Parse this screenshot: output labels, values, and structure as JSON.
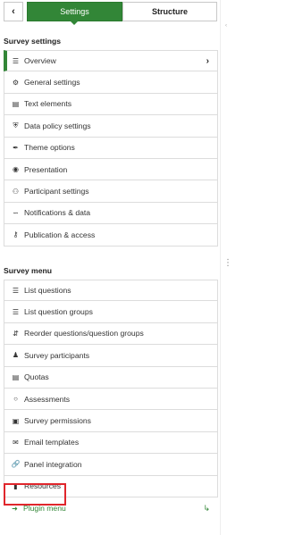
{
  "tabs": {
    "collapse_icon": "chevron-left",
    "settings_label": "Settings",
    "structure_label": "Structure"
  },
  "survey_settings": {
    "title": "Survey settings",
    "items": [
      {
        "label": "Overview",
        "icon": "list-icon"
      },
      {
        "label": "General settings",
        "icon": "cogs-icon"
      },
      {
        "label": "Text elements",
        "icon": "file-text-icon"
      },
      {
        "label": "Data policy settings",
        "icon": "shield-icon"
      },
      {
        "label": "Theme options",
        "icon": "paint-brush-icon"
      },
      {
        "label": "Presentation",
        "icon": "eye-slash-icon"
      },
      {
        "label": "Participant settings",
        "icon": "users-icon"
      },
      {
        "label": "Notifications & data",
        "icon": "rss-icon"
      },
      {
        "label": "Publication & access",
        "icon": "key-icon"
      }
    ]
  },
  "survey_menu": {
    "title": "Survey menu",
    "items": [
      {
        "label": "List questions",
        "icon": "list-icon"
      },
      {
        "label": "List question groups",
        "icon": "list-icon"
      },
      {
        "label": "Reorder questions/question groups",
        "icon": "reorder-icon"
      },
      {
        "label": "Survey participants",
        "icon": "user-icon"
      },
      {
        "label": "Quotas",
        "icon": "tasks-icon"
      },
      {
        "label": "Assessments",
        "icon": "comment-icon"
      },
      {
        "label": "Survey permissions",
        "icon": "lock-icon"
      },
      {
        "label": "Email templates",
        "icon": "envelope-icon"
      },
      {
        "label": "Panel integration",
        "icon": "link-icon"
      },
      {
        "label": "Resources",
        "icon": "file-icon"
      },
      {
        "label": "Plugin menu",
        "icon": "arrow-right-icon"
      }
    ]
  },
  "colors": {
    "accent": "#328637",
    "highlight_border": "#e0262c"
  }
}
